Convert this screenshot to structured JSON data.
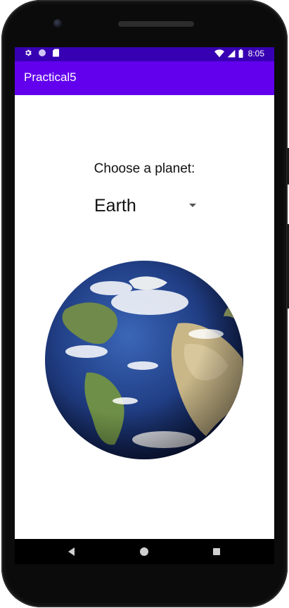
{
  "statusbar": {
    "time": "8:05",
    "left_icons": [
      "settings-gear-icon",
      "circle-notification-icon",
      "sd-card-icon"
    ],
    "right_icons": [
      "wifi-icon",
      "cellular-signal-icon",
      "battery-icon"
    ]
  },
  "app": {
    "title": "Practical5"
  },
  "main": {
    "prompt": "Choose a planet:",
    "planet_spinner": {
      "selected": "Earth"
    },
    "planet_image": "earth-image"
  },
  "navigation": {
    "buttons": [
      "back",
      "home",
      "recents"
    ]
  },
  "colors": {
    "statusbar": "#3700b3",
    "appbar": "#6200ee",
    "background": "#ffffff",
    "navbar": "#000000"
  }
}
